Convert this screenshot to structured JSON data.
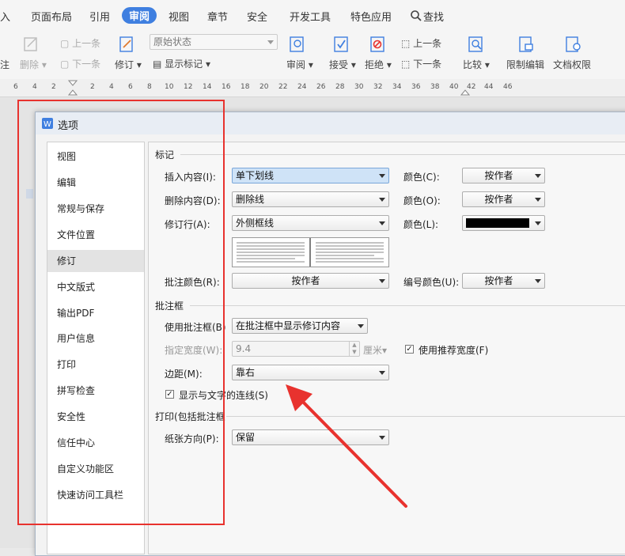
{
  "menu": {
    "tabs": [
      "入",
      "页面布局",
      "引用",
      "审阅",
      "视图",
      "章节",
      "安全",
      "开发工具",
      "特色应用"
    ],
    "active": "审阅",
    "search": "查找"
  },
  "toolbar": {
    "comment_label": "注",
    "delete_label": "删除",
    "prev_label": "上一条",
    "next_label": "下一条",
    "revise_label": "修订",
    "state_value": "原始状态",
    "show_marks_label": "显示标记",
    "review_label": "审阅",
    "accept_label": "接受",
    "reject_label": "拒绝",
    "prev2_label": "上一条",
    "next2_label": "下一条",
    "compare_label": "比较",
    "restrict_label": "限制编辑",
    "rights_label": "文档权限"
  },
  "ruler": {
    "ticks": [
      "6",
      "4",
      "2",
      "2",
      "4",
      "6",
      "8",
      "10",
      "12",
      "14",
      "16",
      "18",
      "20",
      "22",
      "24",
      "26",
      "28",
      "30",
      "32",
      "34",
      "36",
      "38",
      "40",
      "42",
      "44",
      "46"
    ]
  },
  "dialog": {
    "title": "选项",
    "nav": [
      "视图",
      "编辑",
      "常规与保存",
      "文件位置",
      "修订",
      "中文版式",
      "输出PDF",
      "用户信息",
      "打印",
      "拼写检查",
      "安全性",
      "信任中心",
      "自定义功能区",
      "快速访问工具栏"
    ],
    "selected_nav": "修订",
    "marks": {
      "group": "标记",
      "insert_label": "插入内容(I):",
      "insert_value": "单下划线",
      "insert_color_label": "颜色(C):",
      "insert_color_value": "按作者",
      "delete_label": "删除内容(D):",
      "delete_value": "删除线",
      "delete_color_label": "颜色(O):",
      "delete_color_value": "按作者",
      "line_label": "修订行(A):",
      "line_value": "外侧框线",
      "line_color_label": "颜色(L):",
      "line_color_swatch": "#000000",
      "comment_color_label": "批注颜色(R):",
      "comment_color_value": "按作者",
      "number_color_label": "编号颜色(U):",
      "number_color_value": "按作者"
    },
    "balloon": {
      "group": "批注框",
      "use_label": "使用批注框(B)",
      "use_value": "在批注框中显示修订内容",
      "width_label": "指定宽度(W):",
      "width_value": "9.4",
      "width_unit": "厘米",
      "recommended_label": "使用推荐宽度(F)",
      "recommended_checked": true,
      "margin_label": "边距(M):",
      "margin_value": "靠右",
      "connect_label": "显示与文字的连线(S)",
      "connect_checked": true
    },
    "print": {
      "group": "打印(包括批注框",
      "orientation_label": "纸张方向(P):",
      "orientation_value": "保留"
    }
  },
  "colors": {
    "accent": "#3f7fe0",
    "highlight": "#e8322e"
  }
}
